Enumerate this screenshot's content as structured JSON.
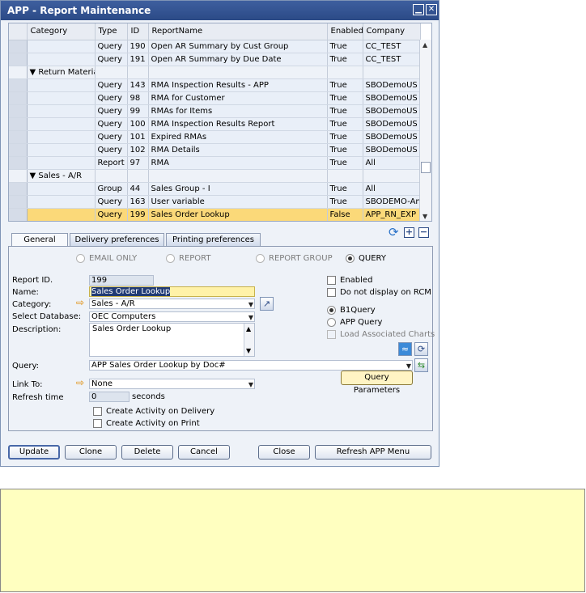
{
  "window": {
    "title": "APP - Report Maintenance",
    "minimize_glyph": "▁",
    "close_glyph": "✕"
  },
  "grid": {
    "columns": [
      "Category",
      "Type",
      "ID",
      "ReportName",
      "Enabled",
      "Company"
    ],
    "rows": [
      {
        "kind": "data",
        "category": "",
        "type": "Query",
        "id": "190",
        "name": "Open AR Summary by Cust Group",
        "enabled": "True",
        "company": "CC_TEST"
      },
      {
        "kind": "data",
        "category": "",
        "type": "Query",
        "id": "191",
        "name": "Open AR Summary by Due Date",
        "enabled": "True",
        "company": "CC_TEST"
      },
      {
        "kind": "group",
        "category": "▼ Return Material",
        "type": "",
        "id": "",
        "name": "",
        "enabled": "",
        "company": ""
      },
      {
        "kind": "data",
        "category": "",
        "type": "Query",
        "id": "143",
        "name": "RMA Inspection Results - APP",
        "enabled": "True",
        "company": "SBODemoUS"
      },
      {
        "kind": "data",
        "category": "",
        "type": "Query",
        "id": "98",
        "name": "RMA for Customer",
        "enabled": "True",
        "company": "SBODemoUS"
      },
      {
        "kind": "data",
        "category": "",
        "type": "Query",
        "id": "99",
        "name": "RMAs for Items",
        "enabled": "True",
        "company": "SBODemoUS"
      },
      {
        "kind": "data",
        "category": "",
        "type": "Query",
        "id": "100",
        "name": "RMA Inspection Results Report",
        "enabled": "True",
        "company": "SBODemoUS"
      },
      {
        "kind": "data",
        "category": "",
        "type": "Query",
        "id": "101",
        "name": "Expired RMAs",
        "enabled": "True",
        "company": "SBODemoUS"
      },
      {
        "kind": "data",
        "category": "",
        "type": "Query",
        "id": "102",
        "name": "RMA Details",
        "enabled": "True",
        "company": "SBODemoUS"
      },
      {
        "kind": "data",
        "category": "",
        "type": "Report",
        "id": "97",
        "name": "RMA",
        "enabled": "True",
        "company": "All"
      },
      {
        "kind": "group",
        "category": "▼ Sales - A/R",
        "type": "",
        "id": "",
        "name": "",
        "enabled": "",
        "company": ""
      },
      {
        "kind": "data",
        "category": "",
        "type": "Group",
        "id": "44",
        "name": "Sales Group - I",
        "enabled": "True",
        "company": "All"
      },
      {
        "kind": "data",
        "category": "",
        "type": "Query",
        "id": "163",
        "name": "User variable",
        "enabled": "True",
        "company": "SBODEMO-Anc"
      },
      {
        "kind": "data",
        "category": "",
        "type": "Query",
        "id": "199",
        "name": "Sales Order Lookup",
        "enabled": "False",
        "company": "APP_RN_EXP",
        "active": true
      }
    ]
  },
  "tabs": [
    "General",
    "Delivery preferences",
    "Printing preferences"
  ],
  "report_type": {
    "options": [
      "EMAIL ONLY",
      "REPORT",
      "REPORT GROUP",
      "QUERY"
    ],
    "selected": "QUERY"
  },
  "form": {
    "report_id_label": "Report ID.",
    "report_id": "199",
    "name_label": "Name:",
    "name": "Sales Order Lookup",
    "category_label": "Category:",
    "category": "Sales - A/R",
    "database_label": "Select Database:",
    "database": "OEC Computers",
    "description_label": "Description:",
    "description": "Sales Order Lookup",
    "query_label": "Query:",
    "query": "APP Sales Order Lookup by Doc#",
    "link_label": "Link To:",
    "link": "None",
    "refresh_label": "Refresh time",
    "refresh": "0",
    "refresh_unit": "seconds",
    "query_params_button": "Query Parameters"
  },
  "options": {
    "enabled": "Enabled",
    "no_display_rcm": "Do not display on RCM",
    "source_options": [
      "B1Query",
      "APP Query"
    ],
    "source_selected": "B1Query",
    "load_charts": "Load Associated Charts",
    "activity_delivery": "Create Activity on Delivery",
    "activity_print": "Create Activity on Print"
  },
  "buttons": {
    "update": "Update",
    "clone": "Clone",
    "delete": "Delete",
    "cancel": "Cancel",
    "close": "Close",
    "refresh": "Refresh APP Menu"
  },
  "colors": {
    "title_bar": "#2b4a86",
    "active_row": "#fbd979",
    "focus_field": "#fff2a8",
    "note_bg": "#ffffc0"
  }
}
